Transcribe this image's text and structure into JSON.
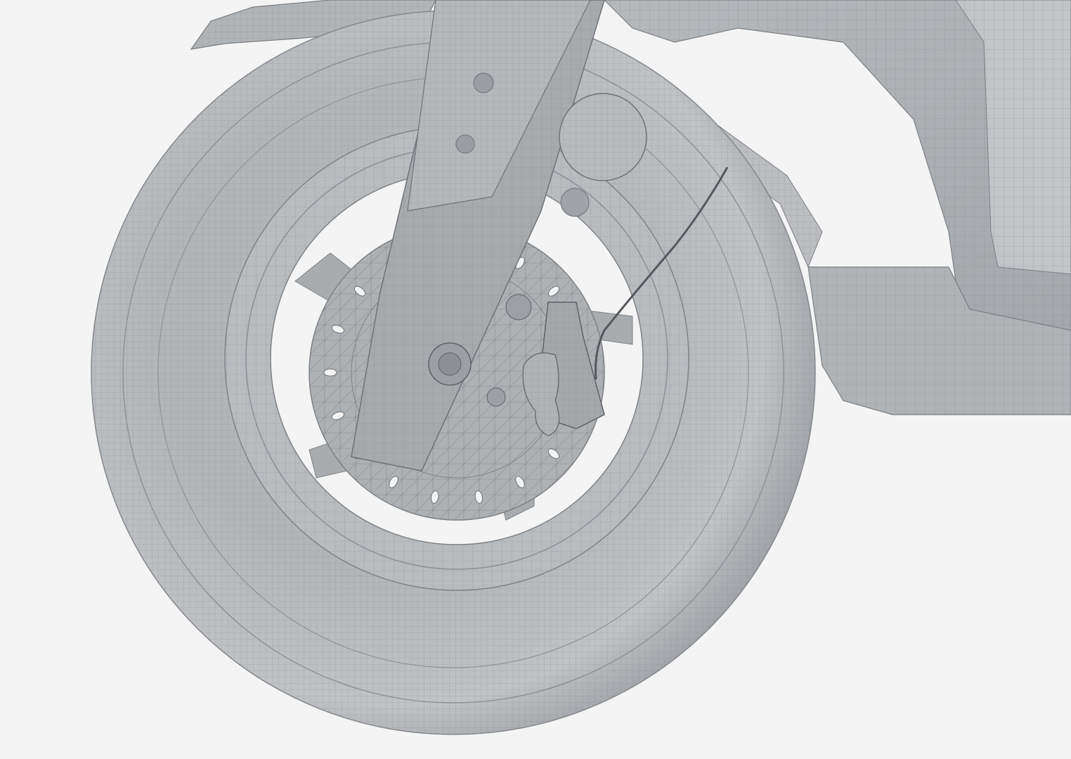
{
  "scene": {
    "subject": "scooter-front-wheel-wireframe",
    "colors": {
      "background": "#f4f4f4",
      "surface": "#a9acaf",
      "surface_light": "#c4c6c8",
      "surface_dark": "#8e9195",
      "wire": "#6f7276",
      "cable": "#55585c"
    },
    "parts": [
      "tire",
      "rim",
      "brake-disc",
      "fork-leg",
      "brake-caliper",
      "fender",
      "body-panel",
      "front-light",
      "brake-cable"
    ]
  }
}
